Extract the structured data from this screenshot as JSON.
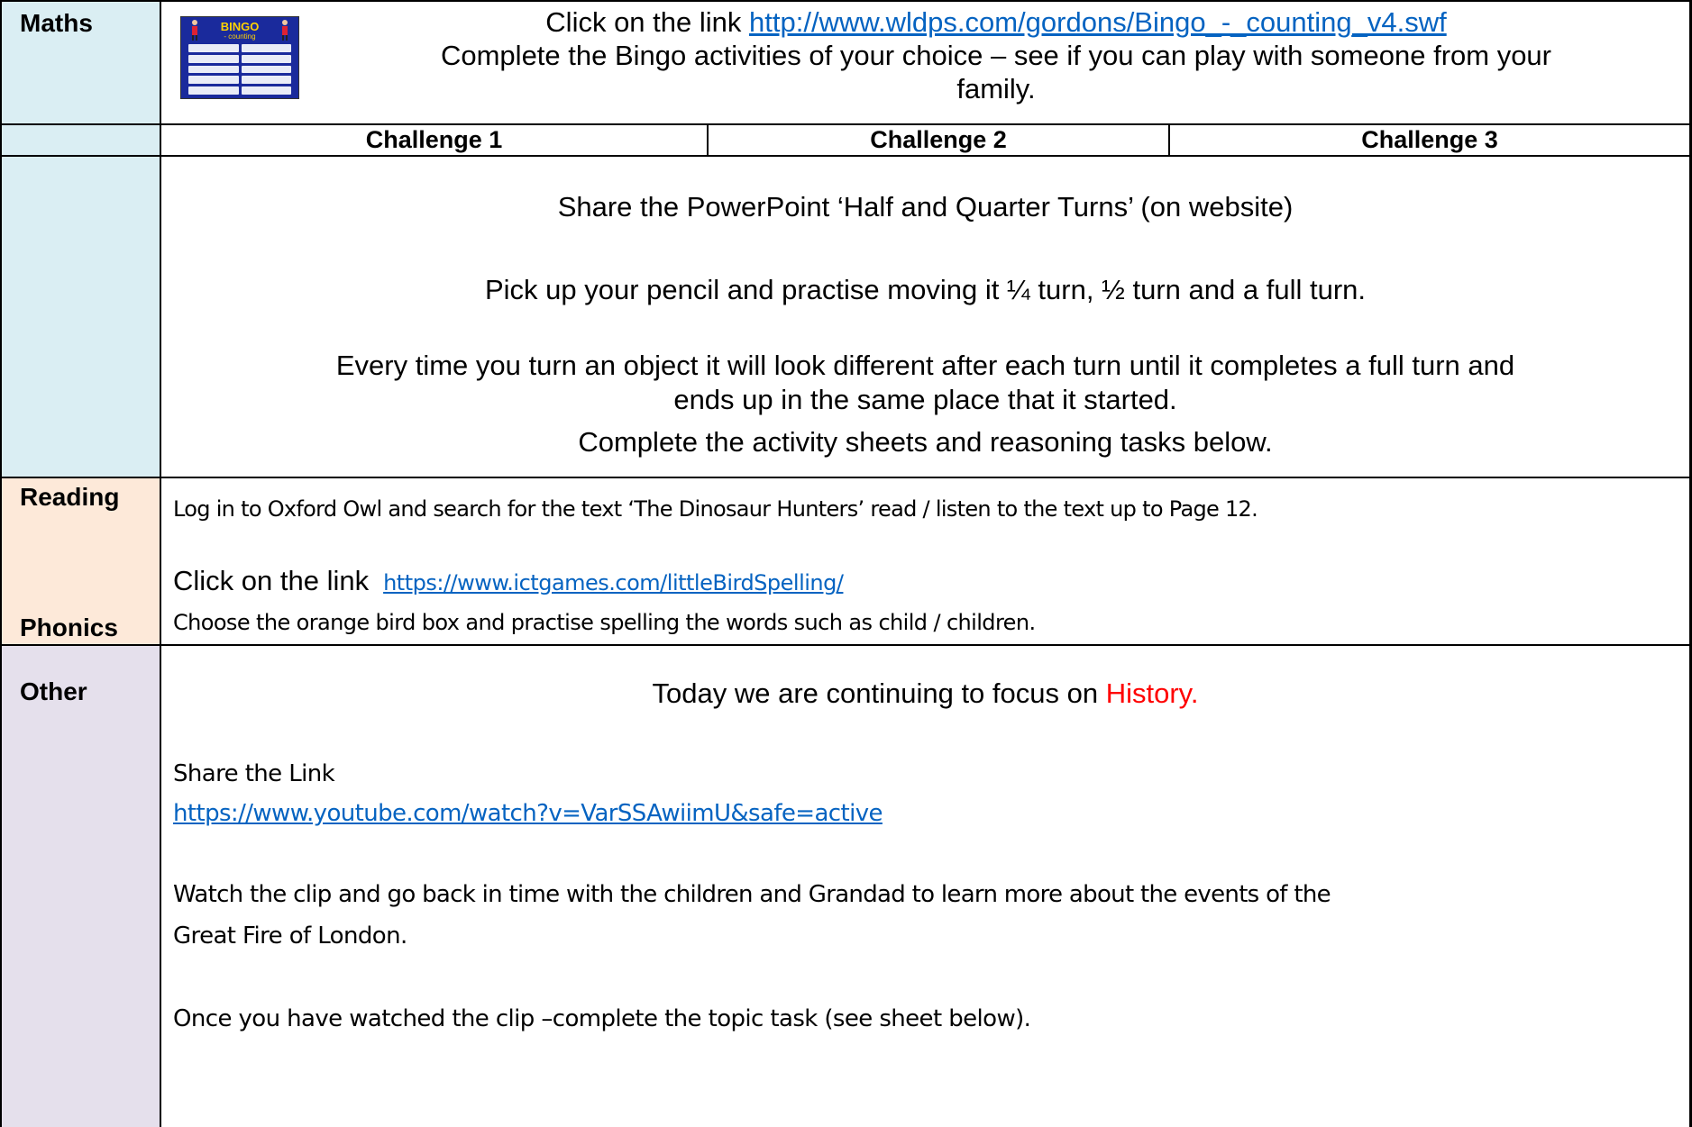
{
  "maths": {
    "label": "Maths",
    "bingo_image": {
      "title": "BINGO",
      "subtitle": "- counting"
    },
    "intro_prefix": "Click on the link ",
    "intro_link": "http://www.wldps.com/gordons/Bingo_-_counting_v4.swf",
    "intro_line2": "Complete the Bingo activities of your choice – see if you can play with someone from your",
    "intro_line3": "family.",
    "challenges": [
      "Challenge 1",
      "Challenge 2",
      "Challenge 3"
    ],
    "para1": "Share the PowerPoint ‘Half and Quarter Turns’ (on website)",
    "para2": "Pick up your pencil and practise moving it ¼ turn, ½ turn and a full turn.",
    "para3_line1": "Every time you turn an object it will look different after each turn until it completes a full turn and",
    "para3_line2": "ends up in the same place that it started.",
    "para4": "Complete the activity sheets and reasoning tasks below."
  },
  "reading": {
    "label_reading": "Reading",
    "label_phonics": "Phonics",
    "line1": "Log in to Oxford Owl and search for the text ‘The Dinosaur Hunters’ read / listen to the text up to Page 12.",
    "link_prefix": "Click on the link",
    "link": "https://www.ictgames.com/littleBirdSpelling/",
    "line3": "Choose the orange bird box and practise spelling the words such as child / children."
  },
  "other": {
    "label": "Other",
    "focus_prefix": "Today we are continuing to focus on ",
    "focus_subject": "History.",
    "share_label": "Share the Link",
    "share_link": "https://www.youtube.com/watch?v=VarSSAwiimU&safe=active",
    "watch_line1": "Watch the clip and go back in time with the children and Grandad to learn more about the events of the",
    "watch_line2": "Great Fire of London.",
    "task_line": "Once you have watched the clip –complete the topic task (see sheet below)."
  },
  "colors": {
    "maths_bg": "#daeef3",
    "reading_bg": "#fde9d9",
    "other_bg": "#e5e0ec",
    "link": "#0563c1",
    "history": "#ff0000"
  }
}
